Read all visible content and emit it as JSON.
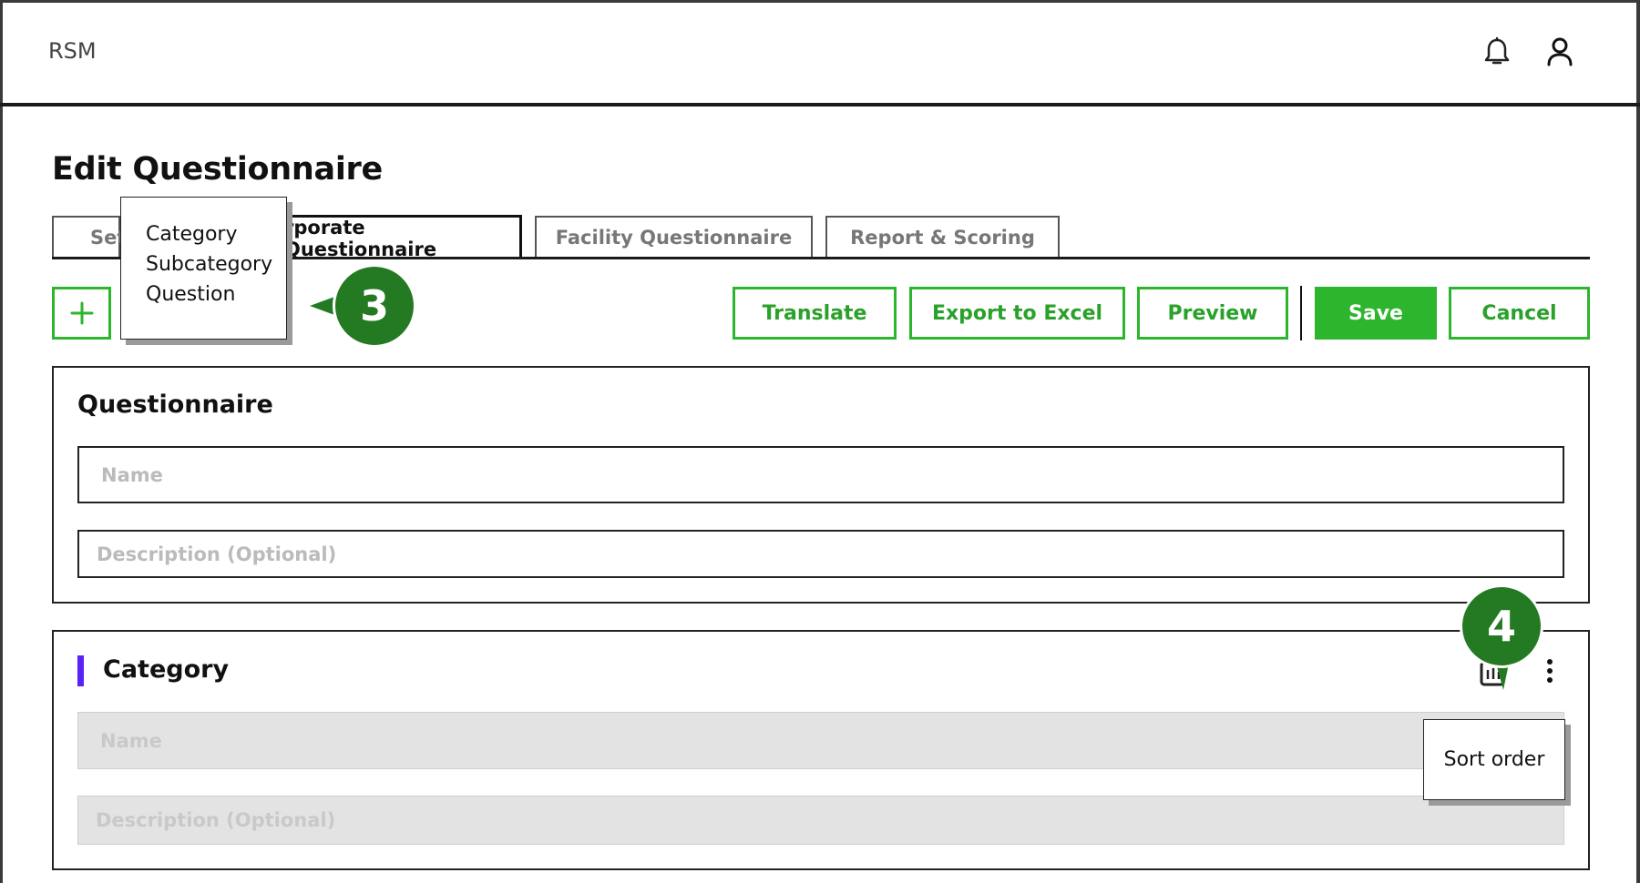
{
  "app": {
    "name": "RSM"
  },
  "header": {
    "notifications_icon": "bell-icon",
    "profile_icon": "user-icon"
  },
  "page": {
    "title": "Edit Questionnaire"
  },
  "tabs": [
    {
      "label": "Set"
    },
    {
      "label": "rporate Questionnaire",
      "active": true
    },
    {
      "label": "Facility Questionnaire"
    },
    {
      "label": "Report & Scoring"
    }
  ],
  "toolbar": {
    "add_icon": "plus-icon",
    "translate_label": "Translate",
    "export_label": "Export to Excel",
    "preview_label": "Preview",
    "save_label": "Save",
    "cancel_label": "Cancel"
  },
  "add_menu": {
    "items": [
      "Category",
      "Subcategory",
      "Question"
    ]
  },
  "callouts": {
    "first": "3",
    "second": "4"
  },
  "questionnaire": {
    "title": "Questionnaire",
    "name_placeholder": "Name",
    "description_placeholder": "Description (Optional)"
  },
  "category": {
    "title": "Category",
    "name_placeholder": "Name",
    "description_placeholder": "Description (Optional)",
    "sort_icon": "sort-order-icon",
    "more_icon": "more-vertical-icon"
  },
  "tooltip": {
    "text": "Sort order"
  },
  "colors": {
    "accent_green": "#2db52d",
    "callout_green": "#247a22",
    "category_marker": "#5a22f5"
  }
}
